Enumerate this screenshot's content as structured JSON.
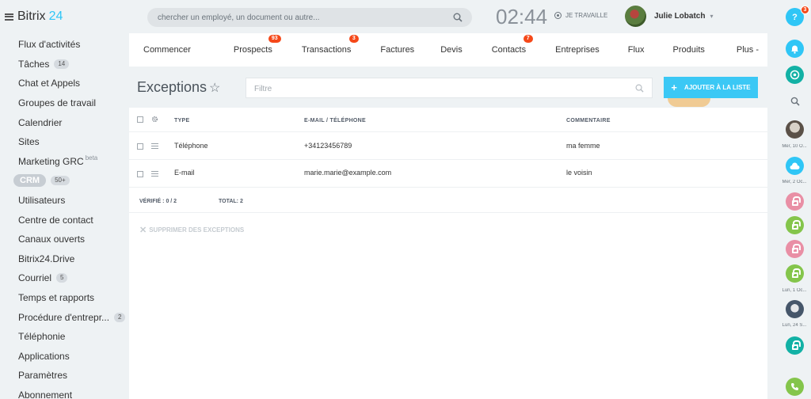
{
  "logo": {
    "part1": "Bitrix",
    "part2": "24"
  },
  "search": {
    "placeholder": "chercher un employé, un document ou autre..."
  },
  "clock": {
    "time": "02:44",
    "status": "JE TRAVAILLE"
  },
  "user": {
    "name": "Julie Lobatch"
  },
  "sidebar": {
    "items": [
      {
        "label": "Flux d'activités"
      },
      {
        "label": "Tâches",
        "count": "14"
      },
      {
        "label": "Chat et Appels"
      },
      {
        "label": "Groupes de travail"
      },
      {
        "label": "Calendrier"
      },
      {
        "label": "Sites"
      },
      {
        "label": "Marketing GRC",
        "sup": "beta"
      },
      {
        "label": "CRM",
        "count": "50+"
      },
      {
        "label": "Utilisateurs"
      },
      {
        "label": "Centre de contact"
      },
      {
        "label": "Canaux ouverts"
      },
      {
        "label": "Bitrix24.Drive"
      },
      {
        "label": "Courriel",
        "count": "5"
      },
      {
        "label": "Temps et rapports"
      },
      {
        "label": "Procédure d'entrepr...",
        "count": "2"
      },
      {
        "label": "Téléphonie"
      },
      {
        "label": "Applications"
      },
      {
        "label": "Paramètres"
      },
      {
        "label": "Abonnement"
      }
    ]
  },
  "tabs": [
    {
      "label": "Commencer"
    },
    {
      "label": "Prospects",
      "badge": "93"
    },
    {
      "label": "Transactions",
      "badge": "3"
    },
    {
      "label": "Factures"
    },
    {
      "label": "Devis"
    },
    {
      "label": "Contacts",
      "badge": "7"
    },
    {
      "label": "Entreprises"
    },
    {
      "label": "Flux"
    },
    {
      "label": "Produits"
    },
    {
      "label": "Plus -"
    }
  ],
  "page": {
    "title": "Exceptions",
    "filter_placeholder": "Filtre",
    "add_button": "AJOUTER À LA LISTE"
  },
  "grid": {
    "headers": {
      "type": "TYPE",
      "contact": "E-MAIL / TÉLÉPHONE",
      "comment": "COMMENTAIRE"
    },
    "rows": [
      {
        "type": "Téléphone",
        "contact": "+34123456789",
        "comment": "ma femme"
      },
      {
        "type": "E-mail",
        "contact": "marie.marie@example.com",
        "comment": "le voisin"
      }
    ],
    "footer": {
      "verified": "VÉRIFIÉ : 0 / 2",
      "total": "TOTAL: 2"
    },
    "delete_action": "SUPPRIMER DES EXCEPTIONS"
  },
  "rightbar": {
    "help_badge": "3",
    "labels": [
      "Mer, 10 O...",
      "Mer, 2 Oc...",
      "Lun, 1 Oc...",
      "Lun, 24 S..."
    ]
  },
  "colors": {
    "accent": "#3bc8f5",
    "badge": "#f54819",
    "help": "#2fc6f6",
    "bell": "#2fc6f6",
    "online": "#12b1a5",
    "lock_pink": "#e98fa5",
    "lock_green": "#84c54b",
    "phone": "#84c54b"
  }
}
